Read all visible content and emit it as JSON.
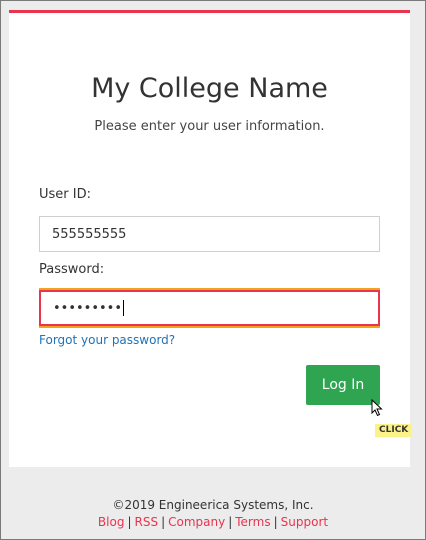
{
  "header": {
    "college_name": "My College Name",
    "instructions": "Please enter your user information."
  },
  "form": {
    "userid_label": "User ID:",
    "userid_value": "555555555",
    "password_label": "Password:",
    "password_value": "•••••••••",
    "forgot_link": "Forgot your password?",
    "login_button": "Log In"
  },
  "overlay": {
    "click_tag": "CLICK"
  },
  "footer": {
    "copyright": "©2019 Engineerica Systems, Inc.",
    "links": [
      "Blog",
      "RSS",
      "Company",
      "Terms",
      "Support"
    ],
    "separator": "|"
  },
  "colors": {
    "accent": "#e8344e",
    "focus_glow": "#f2a21b",
    "button": "#2fa552",
    "link": "#1f73b7"
  },
  "icons": [
    "mouse-cursor-icon"
  ]
}
